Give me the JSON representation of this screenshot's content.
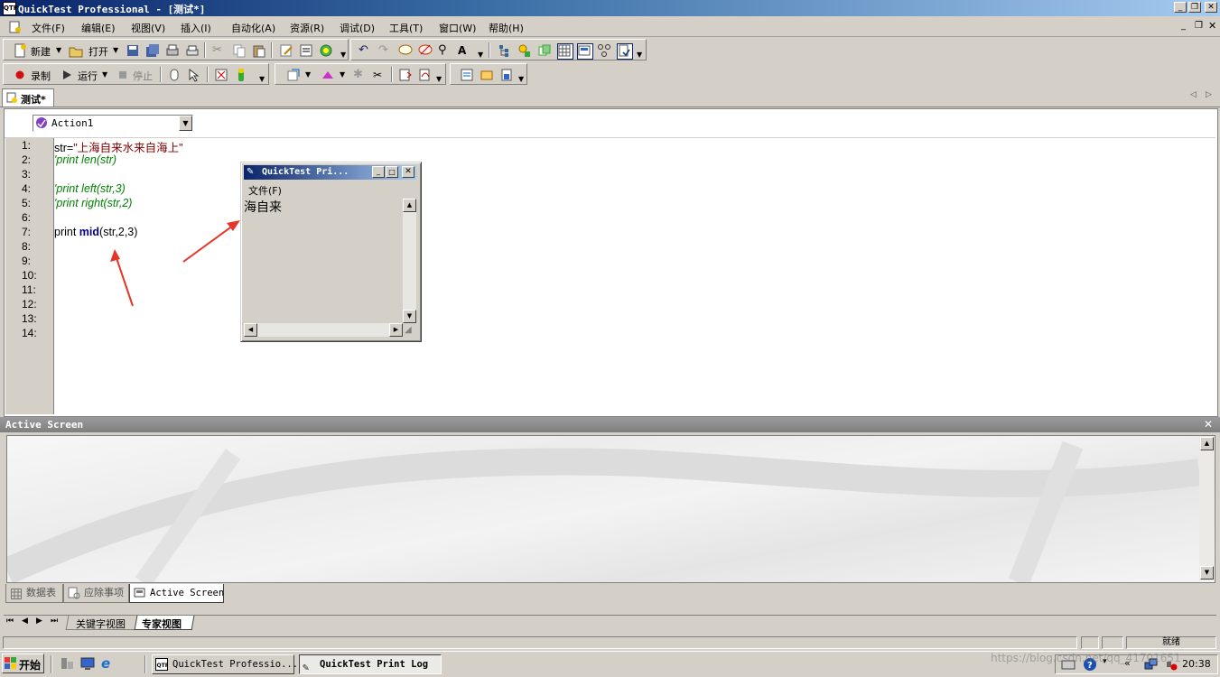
{
  "window": {
    "title": "QuickTest Professional - [测试*]",
    "app_icon": "QTP"
  },
  "menu": [
    "文件(F)",
    "编辑(E)",
    "视图(V)",
    "插入(I)",
    "自动化(A)",
    "资源(R)",
    "调试(D)",
    "工具(T)",
    "窗口(W)",
    "帮助(H)"
  ],
  "toolbar": {
    "new_label": "新建",
    "open_label": "打开",
    "record_label": "录制",
    "run_label": "运行",
    "stop_label": "停止"
  },
  "doc_tab": "测试*",
  "editor": {
    "action_select": "Action1",
    "line_numbers": [
      "1:",
      "2:",
      "3:",
      "4:",
      "5:",
      "6:",
      "7:",
      "8:",
      "9:",
      "10:",
      "11:",
      "12:",
      "13:",
      "14:"
    ],
    "line1_prefix": "str=",
    "line1_string": "\"上海自来水来自海上\"",
    "line2": "'print len(str)",
    "line4": "'print left(str,3)",
    "line5": "'print right(str,2)",
    "line7_a": "print ",
    "line7_kw": "mid",
    "line7_b": "(str,2,3)"
  },
  "print_log": {
    "title": "QuickTest Pri...",
    "menu_file": "文件(F)",
    "output": "海自来"
  },
  "active_screen": {
    "header": "Active Screen"
  },
  "bottom_tabs": [
    "数据表",
    "应除事项",
    "Active Screen"
  ],
  "view_tabs": [
    "关键字视图",
    "专家视图"
  ],
  "status": {
    "ready": "就绪"
  },
  "taskbar": {
    "start": "开始",
    "task1": "QuickTest Professio...",
    "task2": "QuickTest Print Log",
    "clock": "20:38",
    "watermark": "https://blog.csdn.net/qq_41701651"
  },
  "colors": {
    "title_gradient_start": "#0a246a",
    "title_gradient_end": "#a6caf0",
    "string_color": "#800000",
    "comment_color": "#008000",
    "keyword_color": "#000080",
    "arrow_color": "#e53527"
  }
}
